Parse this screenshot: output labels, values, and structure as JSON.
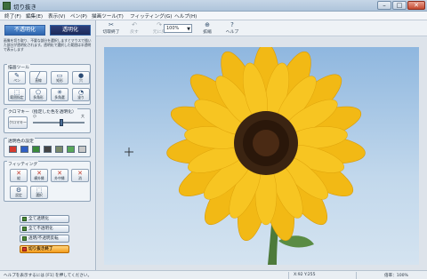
{
  "window": {
    "title": "切り抜き",
    "controls": {
      "minimize": "–",
      "maximize": "□",
      "close": "✕"
    }
  },
  "menu": [
    "終了(F)",
    "編集(E)",
    "表示(V)",
    "ペン(P)",
    "描画ツール(T)",
    "フィッティング(G)",
    "ヘルプ(H)"
  ],
  "toolbar": {
    "items": [
      {
        "label": "切取終了",
        "icon": "✂",
        "enabled": true
      },
      {
        "label": "戻す",
        "icon": "↶",
        "enabled": false
      },
      {
        "label": "元に戻",
        "icon": "↷",
        "enabled": false
      },
      {
        "label": "拡縮",
        "icon": "⊕",
        "enabled": true
      },
      {
        "label": "ヘルプ",
        "icon": "?",
        "enabled": true
      }
    ],
    "zoom_value": "100%"
  },
  "mode": {
    "opaque_label": "不透明化",
    "transparent_label": "透明化"
  },
  "description": "画像を切り取り、不要な部分を選択しますとマウスで描いた部分が透明化されます。透明化で選択した範囲は半透明で表示します",
  "draw_tools": {
    "title": "描画ツール",
    "buttons": [
      {
        "label": "ペン",
        "icon": "✎"
      },
      {
        "label": "直線",
        "icon": "╱"
      },
      {
        "label": "矩形",
        "icon": "▭"
      },
      {
        "label": "穴",
        "icon": "●"
      },
      {
        "label": "範囲指定",
        "icon": "⬚"
      },
      {
        "label": "多角形",
        "icon": "⬠"
      },
      {
        "label": "多角選",
        "icon": "✳"
      },
      {
        "label": "塗り",
        "icon": "◔"
      }
    ]
  },
  "chroma": {
    "title": "クロマキー（指定した色を透明化）",
    "button_label": "クロマキー",
    "scale_low": "小",
    "scale_high": "大",
    "level": 0.55
  },
  "transparent_color": {
    "title": "透明色の設定",
    "colors": [
      "#d63a2f",
      "#2f5fc4",
      "#3a8a3a",
      "#444444",
      "#7a8a6a",
      "#58a858",
      "#c8c8c8"
    ]
  },
  "fitting": {
    "title": "フィッティング",
    "buttons": [
      {
        "label": "縦",
        "icon": "✕"
      },
      {
        "label": "横外縁",
        "icon": "✕"
      },
      {
        "label": "外中縁",
        "icon": "✕"
      },
      {
        "label": "消",
        "icon": "✕"
      },
      {
        "label": "設定",
        "icon": "⚙"
      },
      {
        "label": "選択",
        "icon": "⬚"
      }
    ]
  },
  "commands": [
    {
      "label": "全て透明化"
    },
    {
      "label": "全て不透明化"
    },
    {
      "label": "透明/不透明反転"
    },
    {
      "label": "切り抜き終了"
    }
  ],
  "status": {
    "hint": "ヘルプを表示するには [F1] を押してください。",
    "coords": "X:92 Y:255",
    "zoom": "倍率：100%"
  }
}
